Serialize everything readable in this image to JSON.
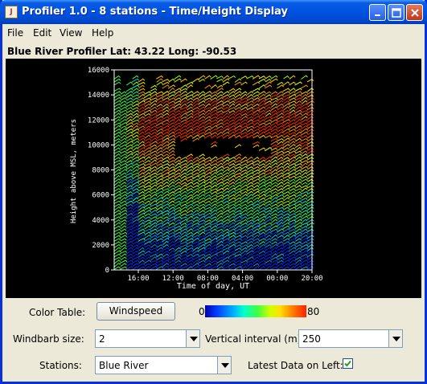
{
  "window": {
    "title": "Profiler 1.0 - 8 stations - Time/Height Display"
  },
  "menu": [
    "File",
    "Edit",
    "View",
    "Help"
  ],
  "header": {
    "station_label": "Blue River Profiler Lat: 43.22  Long: -90.53"
  },
  "plot": {
    "ylabel": "Height above MSL, meters",
    "xlabel": "Time of day, UT",
    "y_ticks": [
      "0",
      "2000",
      "4000",
      "6000",
      "8000",
      "10000",
      "12000",
      "14000",
      "16000"
    ],
    "x_ticks": [
      "16:00",
      "12:00",
      "08:00",
      "04:00",
      "00:00",
      "20:00"
    ],
    "ylim": [
      0,
      16000
    ]
  },
  "controls": {
    "color_table_label": "Color Table:",
    "color_table_button": "Windspeed",
    "colorbar_min": "0",
    "colorbar_max": "80",
    "windbarb_label": "Windbarb size:",
    "windbarb_value": "2",
    "vertical_interval_label": "Vertical interval (m):",
    "vertical_interval_value": "250",
    "stations_label": "Stations:",
    "stations_value": "Blue River",
    "latest_left_label": "Latest Data on Left:",
    "latest_left_checked": true
  },
  "colors": {
    "background": "#ece9d8",
    "plot_bg": "#000000",
    "axis": "#ffffff"
  }
}
